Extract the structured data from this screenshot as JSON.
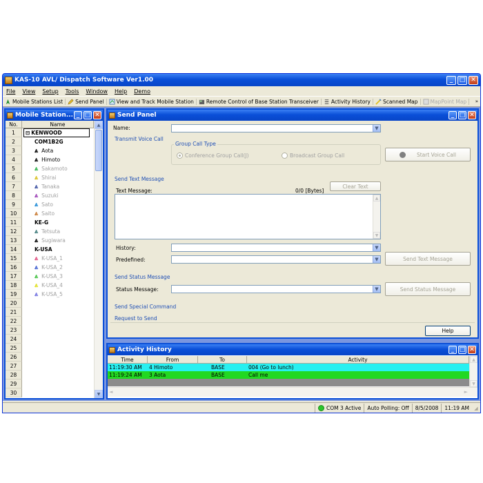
{
  "window": {
    "title": "KAS-10 AVL/ Dispatch Software Ver1.00"
  },
  "menu": [
    "File",
    "View",
    "Setup",
    "Tools",
    "Window",
    "Help",
    "Demo"
  ],
  "toolbar": {
    "items": [
      {
        "label": "Mobile Stations List",
        "icon": "antenna-icon",
        "enabled": true
      },
      {
        "label": "Send Panel",
        "icon": "pencil-icon",
        "enabled": true
      },
      {
        "label": "View and Track Mobile Station",
        "icon": "map-track-icon",
        "enabled": true
      },
      {
        "label": "Remote Control of Base Station Transceiver",
        "icon": "transceiver-icon",
        "enabled": true
      },
      {
        "label": "Activity History",
        "icon": "history-icon",
        "enabled": true
      },
      {
        "label": "Scanned Map",
        "icon": "scanned-map-icon",
        "enabled": true
      },
      {
        "label": "MapPoint Map",
        "icon": "mappoint-icon",
        "enabled": false
      }
    ]
  },
  "mobile_panel": {
    "title": "Mobile Station...",
    "col_no": "No.",
    "col_name": "Name",
    "rows": [
      {
        "no": "1",
        "name": "KENWOOD",
        "type": "group-root",
        "color": "#000000"
      },
      {
        "no": "2",
        "name": "COM1B2G",
        "type": "group",
        "color": "#000000"
      },
      {
        "no": "3",
        "name": "Aota",
        "type": "station",
        "color": "#000000"
      },
      {
        "no": "4",
        "name": "Himoto",
        "type": "station",
        "color": "#000000"
      },
      {
        "no": "5",
        "name": "Sakamoto",
        "type": "station-inactive",
        "color": "#2db34a"
      },
      {
        "no": "6",
        "name": "Shirai",
        "type": "station-inactive",
        "color": "#d8c020"
      },
      {
        "no": "7",
        "name": "Tanaka",
        "type": "station-inactive",
        "color": "#3a4fa0"
      },
      {
        "no": "8",
        "name": "Suzuki",
        "type": "station-inactive",
        "color": "#9b3fb5"
      },
      {
        "no": "9",
        "name": "Sato",
        "type": "station-inactive",
        "color": "#1e8ad6"
      },
      {
        "no": "10",
        "name": "Saito",
        "type": "station-inactive",
        "color": "#c87830"
      },
      {
        "no": "11",
        "name": "KE-G",
        "type": "group",
        "color": "#000000"
      },
      {
        "no": "12",
        "name": "Tetsuta",
        "type": "station-inactive",
        "color": "#3d7a7a"
      },
      {
        "no": "13",
        "name": "Sugiwara",
        "type": "station-inactive",
        "color": "#000000"
      },
      {
        "no": "14",
        "name": "K-USA",
        "type": "group",
        "color": "#000000"
      },
      {
        "no": "15",
        "name": "K-USA_1",
        "type": "station-inactive",
        "color": "#e05080"
      },
      {
        "no": "16",
        "name": "K-USA_2",
        "type": "station-inactive",
        "color": "#4060d0"
      },
      {
        "no": "17",
        "name": "K-USA_3",
        "type": "station-inactive",
        "color": "#40c040"
      },
      {
        "no": "18",
        "name": "K-USA_4",
        "type": "station-inactive",
        "color": "#e0e020"
      },
      {
        "no": "19",
        "name": "K-USA_5",
        "type": "station-inactive",
        "color": "#7070e0"
      },
      {
        "no": "20",
        "name": "",
        "type": "empty"
      },
      {
        "no": "21",
        "name": "",
        "type": "empty"
      },
      {
        "no": "22",
        "name": "",
        "type": "empty"
      },
      {
        "no": "23",
        "name": "",
        "type": "empty"
      },
      {
        "no": "24",
        "name": "",
        "type": "empty"
      },
      {
        "no": "25",
        "name": "",
        "type": "empty"
      },
      {
        "no": "26",
        "name": "",
        "type": "empty"
      },
      {
        "no": "27",
        "name": "",
        "type": "empty"
      },
      {
        "no": "28",
        "name": "",
        "type": "empty"
      },
      {
        "no": "29",
        "name": "",
        "type": "empty"
      },
      {
        "no": "30",
        "name": "",
        "type": "empty"
      }
    ]
  },
  "send_panel": {
    "title": "Send Panel",
    "name_label": "Name:",
    "name_value": "",
    "transmit_voice_call": "Transmit Voice Call",
    "group_call_type": "Group Call Type",
    "conference_group_call": "Conference Group Call(J)",
    "broadcast_group_call": "Broadcast Group Call",
    "start_voice_call": "Start Voice Call",
    "send_text_message": "Send Text Message",
    "text_message_label": "Text Message:",
    "byte_count": "0/0 [Bytes]",
    "clear_text": "Clear Text",
    "text_message_value": "",
    "history_label": "History:",
    "history_value": "",
    "predefined_label": "Predefined:",
    "predefined_value": "",
    "send_text_message_button": "Send Text Message",
    "send_status_message": "Send Status Message",
    "status_message_label": "Status Message:",
    "status_message_value": "",
    "send_status_message_button": "Send Status Message",
    "send_special_command": "Send Special Command",
    "request_to_send": "Request to Send",
    "help_button": "Help"
  },
  "activity_history": {
    "title": "Activity History",
    "columns": [
      "Time",
      "From",
      "To",
      "Activity"
    ],
    "rows": [
      {
        "time": "11:19:30 AM",
        "from": "4  Himoto",
        "to": "BASE",
        "activity": "004 (Go to lunch)",
        "color": "#28f0f0"
      },
      {
        "time": "11:19:24 AM",
        "from": "3  Aota",
        "to": "BASE",
        "activity": "Call me",
        "color": "#22d822"
      }
    ]
  },
  "status_bar": {
    "com_status": "COM 3 Active",
    "polling": "Auto Polling: Off",
    "date": "8/5/2008",
    "time": "11:19 AM",
    "com_color": "#2cc52c"
  }
}
